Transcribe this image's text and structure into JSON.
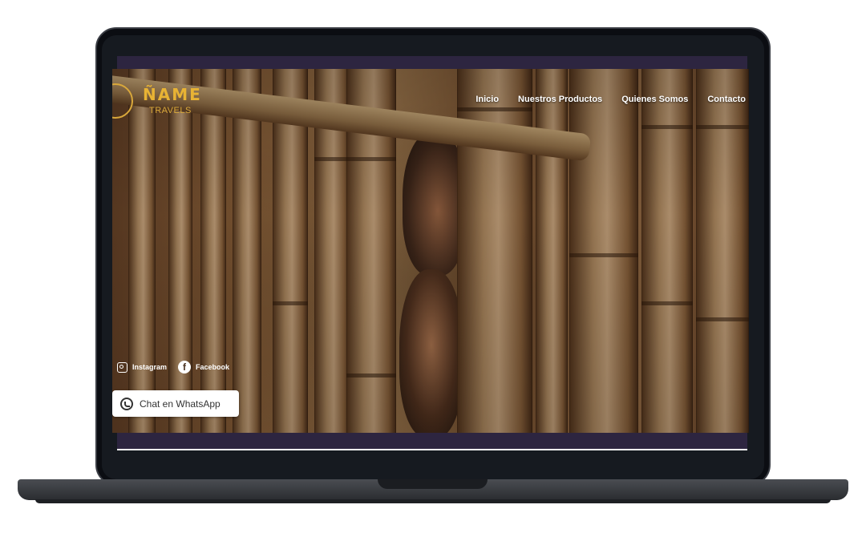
{
  "site": {
    "logo_title": "ÑAME",
    "logo_subtitle": "TRAVELS"
  },
  "nav": {
    "items": [
      {
        "label": "Inicio"
      },
      {
        "label": "Nuestros Productos"
      },
      {
        "label": "Quienes Somos"
      },
      {
        "label": "Contacto"
      }
    ]
  },
  "social": {
    "instagram_label": "Instagram",
    "facebook_label": "Facebook"
  },
  "whatsapp": {
    "label": "Chat en WhatsApp"
  },
  "hero": {
    "image": "children-behind-bamboo-fence"
  },
  "colors": {
    "accent": "#e8b334",
    "frame_bar": "#2d2540"
  }
}
